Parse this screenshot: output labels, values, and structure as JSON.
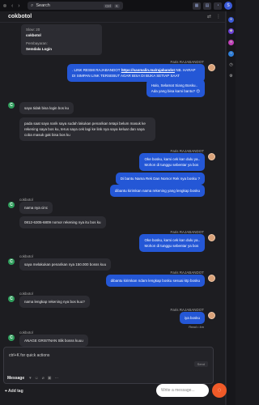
{
  "browser": {
    "search_label": "Search",
    "kbd_ctrl": "Ctrl",
    "kbd_k": "K",
    "avatar_initial": "S"
  },
  "chat": {
    "title": "cokbotol"
  },
  "card": {
    "line1_key": "Slow: 20",
    "line1_val": "cokbotol",
    "line2_key": "Pembayaran:",
    "line2_val": "Semdala Login"
  },
  "messages": {
    "out1": {
      "sender": "Faris RAJABANDOT",
      "text_pre": ". LINK RESMI RAJABANDOT ",
      "link": "https://sasmalin.ma/rajabandot",
      "text_post": " NB. HARAP DI SIMPAN LINK TERSEBUT AGAR BISA DI BUKA SETIAP SAAT"
    },
    "out2": {
      "line1": "Halo, Selamat Siang Bosku..",
      "line2": "Ada yang bisa kami bantu? 😊"
    },
    "in1": {
      "sender": "cokbotol",
      "text": "saya tidak bisa login bos ku"
    },
    "in2": {
      "text": "pada saat saya narik saya sudah lakukan penarikan tetapi belum masuk ke rekening saya bos ku, terus saya cek lagi ke link nya saya keluar dan saya coba masuk gak bisa bos ku"
    },
    "out3": {
      "sender": "Faris RAJABANDOT",
      "line1": "Oke bosku, kami cek kan dulu ya..",
      "line2": "Mohon di tunggu sebentar ya bos"
    },
    "out4": {
      "text": "Di bantu Nama Rek Dan Nomor Rek nya bosku ?"
    },
    "out5": {
      "text": "dibantu kirimkan nama rekening yang lengkap bosku"
    },
    "in3": {
      "sender": "cokbotol",
      "text": "nama nya cinc"
    },
    "in4": {
      "text": "0812-6305-6809 nomor rekening nya itu bos ku"
    },
    "out6": {
      "sender": "Faris RAJABANDOT",
      "line1": "Oke bosku, kami cek kan dulu ya..",
      "line2": "Mohon di tunggu sebentar ya bos"
    },
    "in5": {
      "sender": "cokbotol",
      "text": "saya melakukan penarikan nya 150.000 bosss kuu"
    },
    "out7": {
      "sender": "Faris RAJABANDOT",
      "text": "dibantu kirimkan ndam lengkap bosku sesuai ktp bosku"
    },
    "in6": {
      "sender": "cokbotol",
      "text": "nama lengkap rekening nya bos kuu?"
    },
    "out8": {
      "sender": "Faris RAJABANDOT",
      "text": "iya bosku",
      "read": "Read • 4m"
    },
    "in7": {
      "sender": "cokbotol",
      "text": "ANAGE GRISTNAN Slik bosss kuuu",
      "time": "1m"
    }
  },
  "composer": {
    "text": "ctrl+K for quick actions",
    "tab_label": "Message",
    "send_label": "Send",
    "add_tag": "Add tag"
  },
  "widget": {
    "placeholder": "Write a message..."
  }
}
